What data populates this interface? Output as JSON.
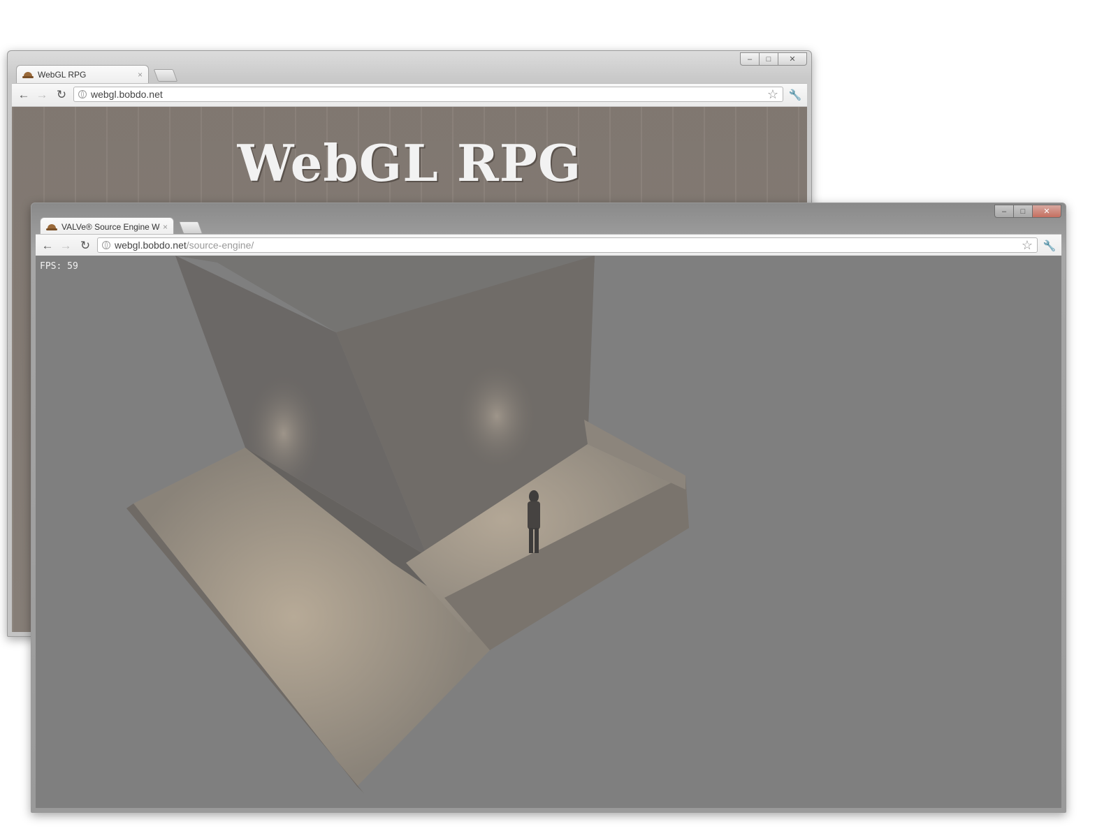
{
  "back_window": {
    "tab": {
      "title": "WebGL RPG",
      "close": "×"
    },
    "address": {
      "host": "webgl.bobdo.net",
      "path": ""
    },
    "content": {
      "heading": "WebGL RPG"
    }
  },
  "front_window": {
    "tab": {
      "title": "VALVe® Source Engine We",
      "close": "×"
    },
    "address": {
      "host": "webgl.bobdo.net",
      "path": "/source-engine/"
    },
    "content": {
      "fps_label": "FPS: 59"
    }
  },
  "window_controls": {
    "minimize": "–",
    "maximize": "□",
    "close": "✕"
  },
  "nav_icons": {
    "back": "←",
    "forward": "→",
    "reload": "↻",
    "bookmark": "☆",
    "wrench": "🔧"
  }
}
